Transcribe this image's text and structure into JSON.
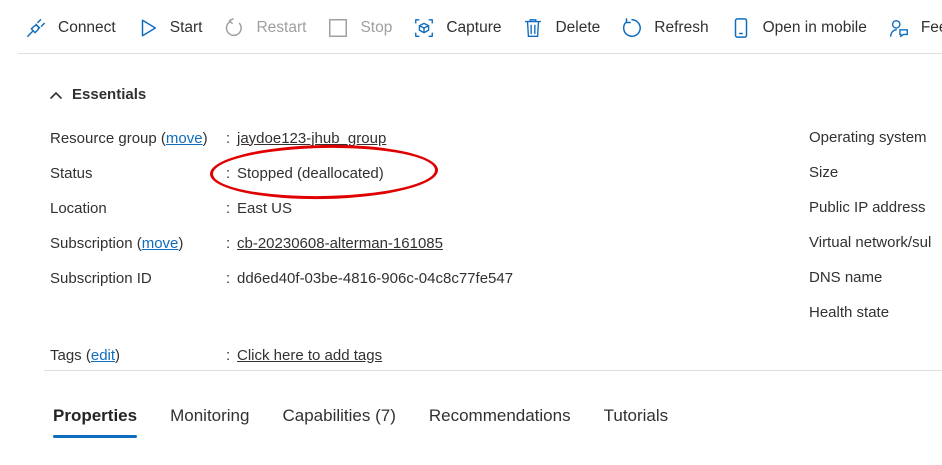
{
  "toolbar": {
    "connect": "Connect",
    "start": "Start",
    "restart": "Restart",
    "stop": "Stop",
    "capture": "Capture",
    "delete": "Delete",
    "refresh": "Refresh",
    "open_in_mobile": "Open in mobile",
    "feedback": "Feedb"
  },
  "essentials": {
    "title": "Essentials",
    "rows": {
      "resource_group": {
        "label": "Resource group (",
        "move": "move",
        "label_end": ")",
        "colon": ":",
        "value": "jaydoe123-jhub_group"
      },
      "status": {
        "label": "Status",
        "colon": ":",
        "value": "Stopped (deallocated)"
      },
      "location": {
        "label": "Location",
        "colon": ":",
        "value": "East US"
      },
      "subscription": {
        "label": "Subscription (",
        "move": "move",
        "label_end": ")",
        "colon": ":",
        "value": "cb-20230608-alterman-161085"
      },
      "subscription_id": {
        "label": "Subscription ID",
        "colon": ":",
        "value": "dd6ed40f-03be-4816-906c-04c8c77fe547"
      },
      "tags": {
        "label": "Tags (",
        "edit": "edit",
        "label_end": ")",
        "colon": ":",
        "value": "Click here to add tags"
      }
    },
    "right_labels": {
      "os": "Operating system",
      "size": "Size",
      "public_ip": "Public IP address",
      "vnet": "Virtual network/sul",
      "dns": "DNS name",
      "health": "Health state"
    }
  },
  "tabs": [
    "Properties",
    "Monitoring",
    "Capabilities (7)",
    "Recommendations",
    "Tutorials"
  ],
  "colors": {
    "accent": "#0f6cbd",
    "annotation": "#e00000",
    "disabled": "#a19f9d"
  }
}
